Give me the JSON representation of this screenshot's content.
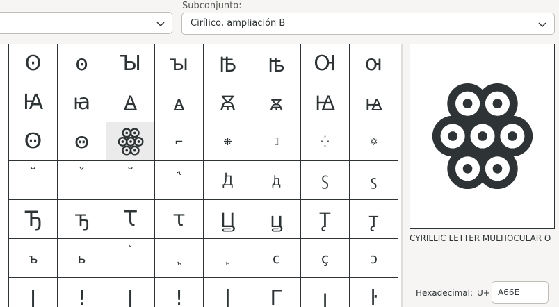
{
  "subset": {
    "label": "Subconjunto:",
    "value": "Cirílico, ampliación B"
  },
  "grid": {
    "rows": [
      [
        "Ꙩ",
        "ꙩ",
        "Ꙑ",
        "ꙑ",
        "Ꙓ",
        "ꙓ",
        "Ꙕ",
        "ꙕ"
      ],
      [
        "Ꙗ",
        "ꙗ",
        "Ꙙ",
        "ꙙ",
        "Ꙛ",
        "ꙛ",
        "Ꙝ",
        "ꙝ"
      ],
      [
        "Ꙫ",
        "ꙫ",
        "",
        "⌐",
        "⁜",
        "⌷",
        "⁛",
        "✡"
      ],
      [
        "˘",
        "ˇ",
        "˘",
        "˞",
        "Ꚁ",
        "ꚁ",
        "Ꚃ",
        "ꚃ"
      ],
      [
        "Ꚋ",
        "ꚋ",
        "Ꚍ",
        "ꚍ",
        "Ꚏ",
        "ꚏ",
        "Ꚑ",
        "ꚑ"
      ],
      [
        "ъ",
        "ь",
        "ꙿ",
        "ꚜ",
        "ꚝ",
        "c",
        "ç",
        "ↄ"
      ],
      [
        "ǀ",
        "ǃ",
        "ǀ",
        "ǃ",
        "|",
        "Г",
        "ꞁ",
        "ŀ"
      ]
    ]
  },
  "preview": {
    "char_name": "CYRILLIC LETTER MULTIOCULAR O"
  },
  "hex": {
    "label": "Hexadecimal:",
    "prefix": "U+",
    "value": "A66E"
  },
  "icons": {
    "dropdown": "chevron-down-icon"
  }
}
